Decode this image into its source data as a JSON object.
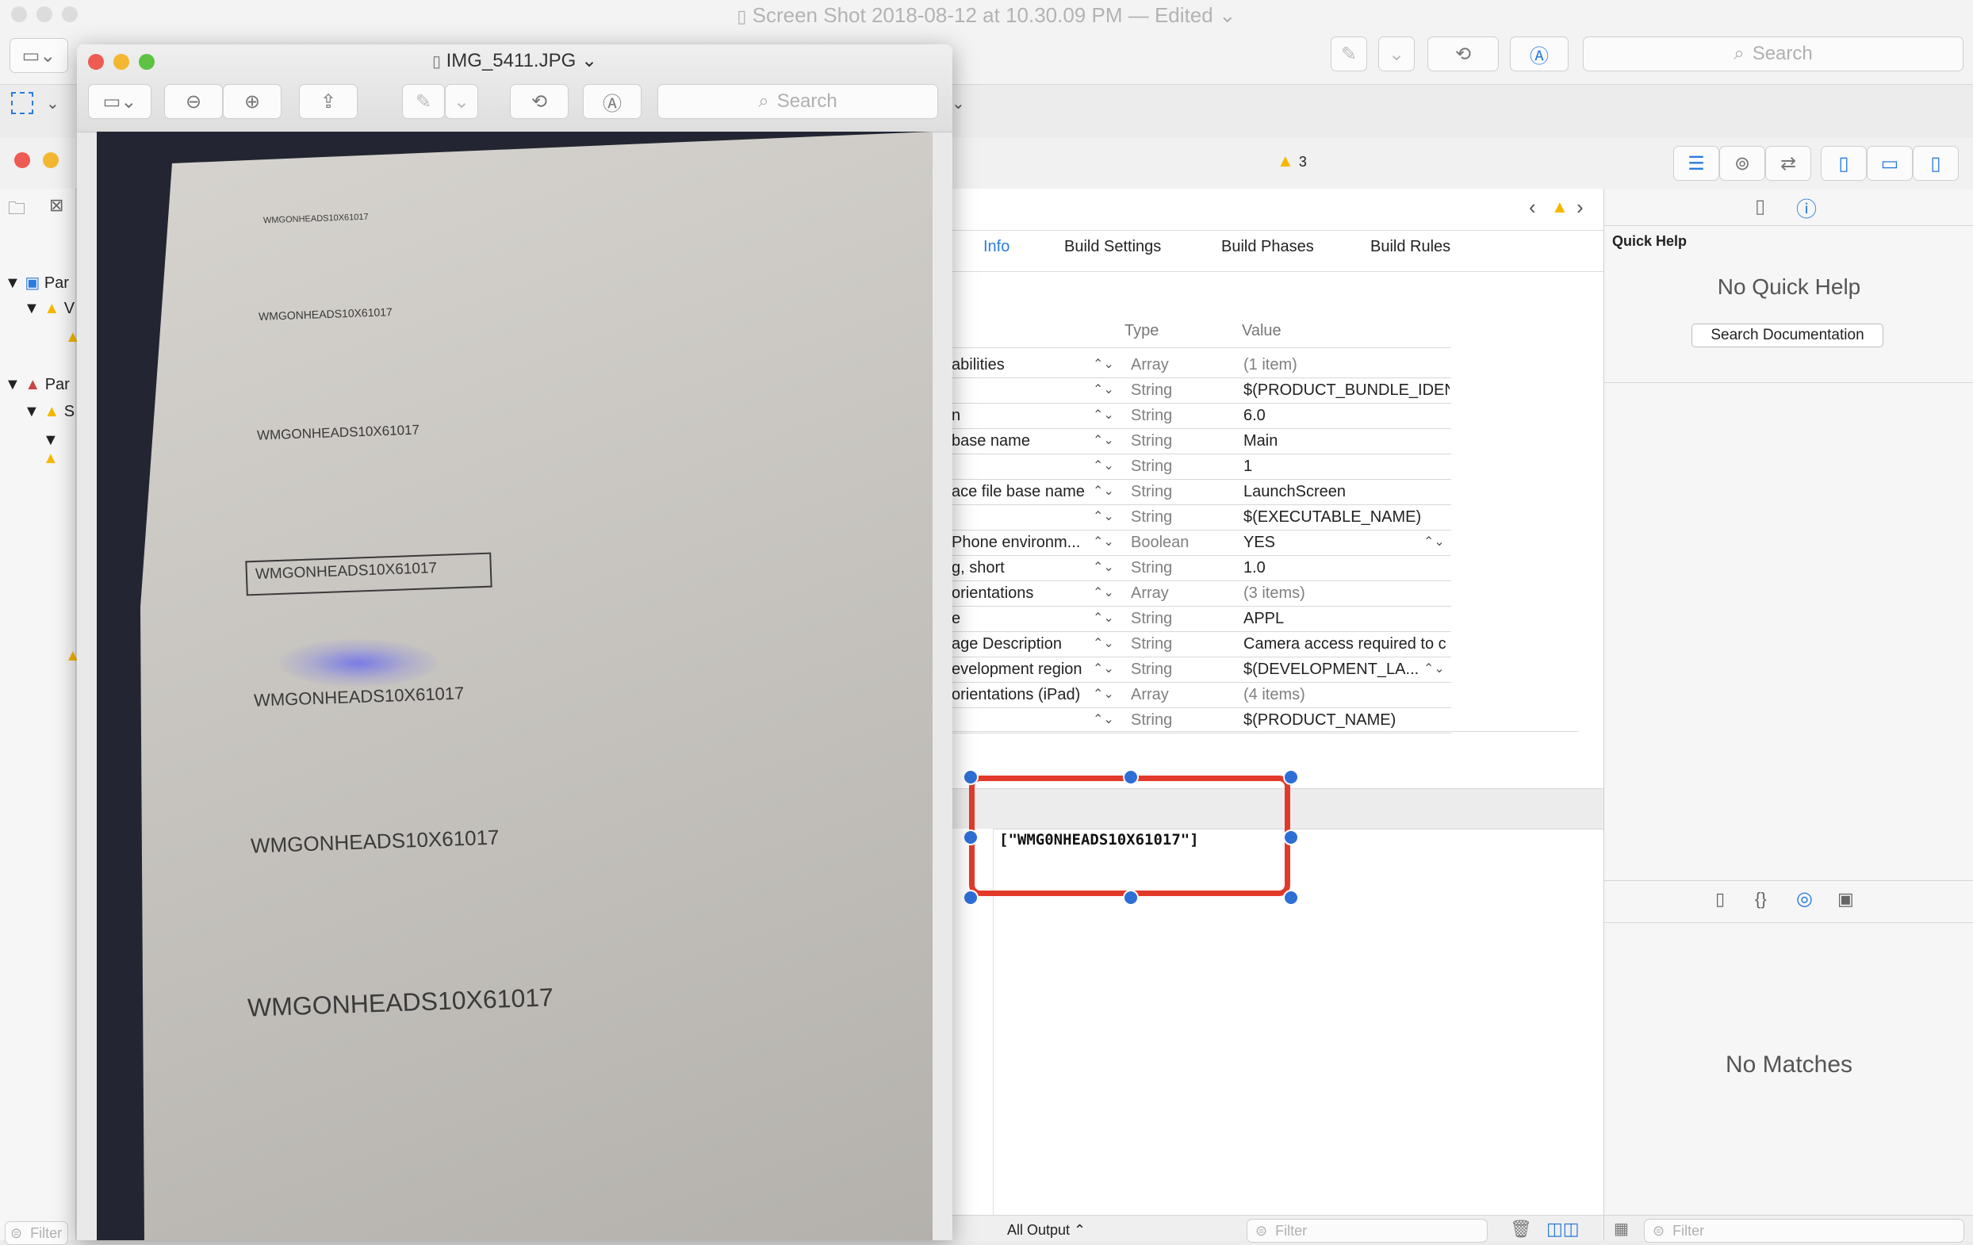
{
  "outer": {
    "title": "Screen Shot 2018-08-12 at 10.30.09 PM",
    "edited": "— Edited",
    "search_placeholder": "Search"
  },
  "preview": {
    "title": "IMG_5411.JPG",
    "search_placeholder": "Search",
    "photo_lines": [
      "WMGONHEADS10X61017",
      "WMGONHEADS10X61017",
      "WMGONHEADS10X61017",
      "WMGONHEADS10X61017",
      "WMGONHEADS10X61017",
      "WMGONHEADS10X61017",
      "WMGONHEADS10X61017"
    ]
  },
  "xcode": {
    "warning_count": "3",
    "navigator": {
      "items": [
        "Par",
        "V",
        "Par",
        "S"
      ]
    },
    "tabs": [
      "Info",
      "Build Settings",
      "Build Phases",
      "Build Rules"
    ],
    "plist": {
      "header_type": "Type",
      "header_value": "Value",
      "rows": [
        {
          "key": "abilities",
          "type": "Array",
          "value": "(1 item)"
        },
        {
          "key": "",
          "type": "String",
          "value": "$(PRODUCT_BUNDLE_IDEN"
        },
        {
          "key": "n",
          "type": "String",
          "value": "6.0"
        },
        {
          "key": "base name",
          "type": "String",
          "value": "Main"
        },
        {
          "key": "",
          "type": "String",
          "value": "1"
        },
        {
          "key": "ace file base name",
          "type": "String",
          "value": "LaunchScreen"
        },
        {
          "key": "",
          "type": "String",
          "value": "$(EXECUTABLE_NAME)"
        },
        {
          "key": "Phone environm...",
          "type": "Boolean",
          "value": "YES"
        },
        {
          "key": "g, short",
          "type": "String",
          "value": "1.0"
        },
        {
          "key": "orientations",
          "type": "Array",
          "value": "(3 items)"
        },
        {
          "key": "e",
          "type": "String",
          "value": "APPL"
        },
        {
          "key": "age Description",
          "type": "String",
          "value": "Camera access required to c"
        },
        {
          "key": "evelopment region",
          "type": "String",
          "value": "$(DEVELOPMENT_LA..."
        },
        {
          "key": "orientations (iPad)",
          "type": "Array",
          "value": "(4 items)"
        },
        {
          "key": "",
          "type": "String",
          "value": "$(PRODUCT_NAME)"
        }
      ]
    },
    "console_output": "[\"WMG0NHEADS10X61017\"]",
    "all_output": "All Output ⌃",
    "filter_placeholder": "Filter",
    "quick_help": {
      "title": "Quick Help",
      "empty": "No Quick Help",
      "search_button": "Search Documentation"
    },
    "library_empty": "No Matches"
  },
  "colors": {
    "accent": "#2a7bde",
    "selection": "#e23a2a",
    "warning": "#f5b800"
  }
}
